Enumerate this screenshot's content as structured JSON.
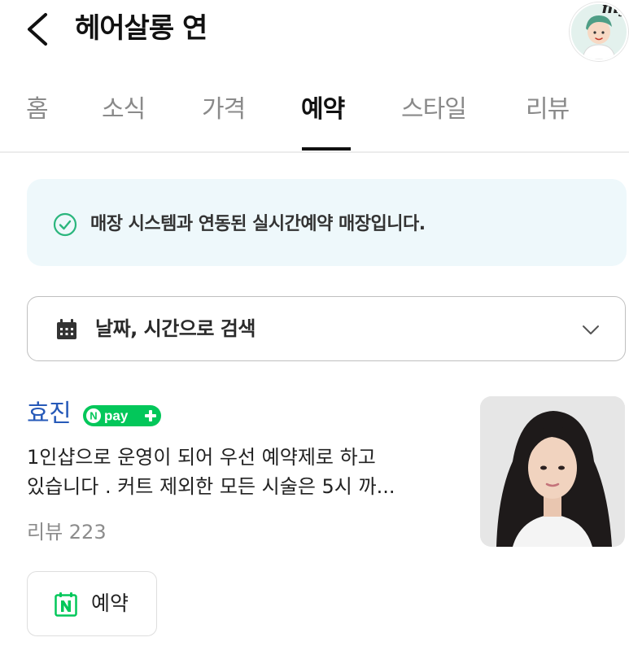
{
  "header": {
    "title": "헤어살롱 연",
    "back_icon": "chevron-left-icon",
    "my_label": "my"
  },
  "tabs": [
    {
      "label": "홈",
      "active": false
    },
    {
      "label": "소식",
      "active": false
    },
    {
      "label": "가격",
      "active": false
    },
    {
      "label": "예약",
      "active": true
    },
    {
      "label": "스타일",
      "active": false
    },
    {
      "label": "리뷰",
      "active": false
    }
  ],
  "notice": {
    "text": "매장 시스템과 연동된 실시간예약 매장입니다.",
    "icon": "check-circle-icon",
    "accent": "#2bb67d",
    "background": "#eef8fb"
  },
  "search": {
    "label": "날짜, 시간으로 검색",
    "icon": "calendar-icon"
  },
  "designer": {
    "name": "효진",
    "badge": "Npay+",
    "description_line1": "1인샵으로 운영이 되어 우선 예약제로 하고",
    "description_line2": "있습니다 . 커트 제외한 모든 시술은 5시 까...",
    "review": "리뷰 223",
    "name_color": "#2659b8",
    "npay_color": "#03c75a"
  },
  "reserve_button": {
    "label": "예약",
    "icon": "naver-n-icon"
  }
}
